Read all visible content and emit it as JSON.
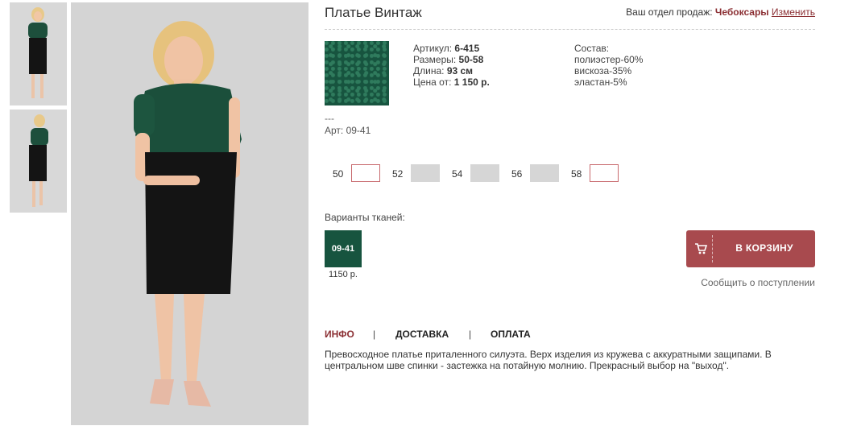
{
  "product": {
    "title": "Платье Винтаж",
    "spec": {
      "article_label": "Артикул:",
      "article_value": "6-415",
      "sizes_label": "Размеры:",
      "sizes_value": "50-58",
      "length_label": "Длина:",
      "length_value": "93 см",
      "price_label": "Цена от:",
      "price_value": "1 150 р."
    },
    "composition": {
      "label": "Состав:",
      "items": [
        "полиэстер-60%",
        "вискоза-35%",
        "эластан-5%"
      ]
    },
    "dash": "---",
    "fabric_article": "Арт: 09-41",
    "fabric_color": "#17543f"
  },
  "region": {
    "label": "Ваш отдел продаж:",
    "city": "Чебоксары",
    "change": "Изменить"
  },
  "sizes": [
    {
      "label": "50",
      "available": true
    },
    {
      "label": "52",
      "available": false
    },
    {
      "label": "54",
      "available": false
    },
    {
      "label": "56",
      "available": false
    },
    {
      "label": "58",
      "available": true
    }
  ],
  "variants": {
    "label": "Варианты тканей:",
    "items": [
      {
        "code": "09-41",
        "price": "1150 р."
      }
    ]
  },
  "cart": {
    "label": "В КОРЗИНУ",
    "icon": "cart-icon",
    "notify": "Сообщить о поступлении"
  },
  "tabs": [
    "ИНФО",
    "ДОСТАВКА",
    "ОПЛАТА"
  ],
  "tab_separator": "|",
  "description": "Превосходное платье приталенного силуэта. Верх изделия из кружева с аккуратными защипами. В центральном шве спинки - застежка на потайную молнию. Прекрасный выбор на \"выход\".",
  "colors": {
    "accent": "#a84a4e",
    "link": "#8b2f33",
    "fabric": "#17543f"
  }
}
